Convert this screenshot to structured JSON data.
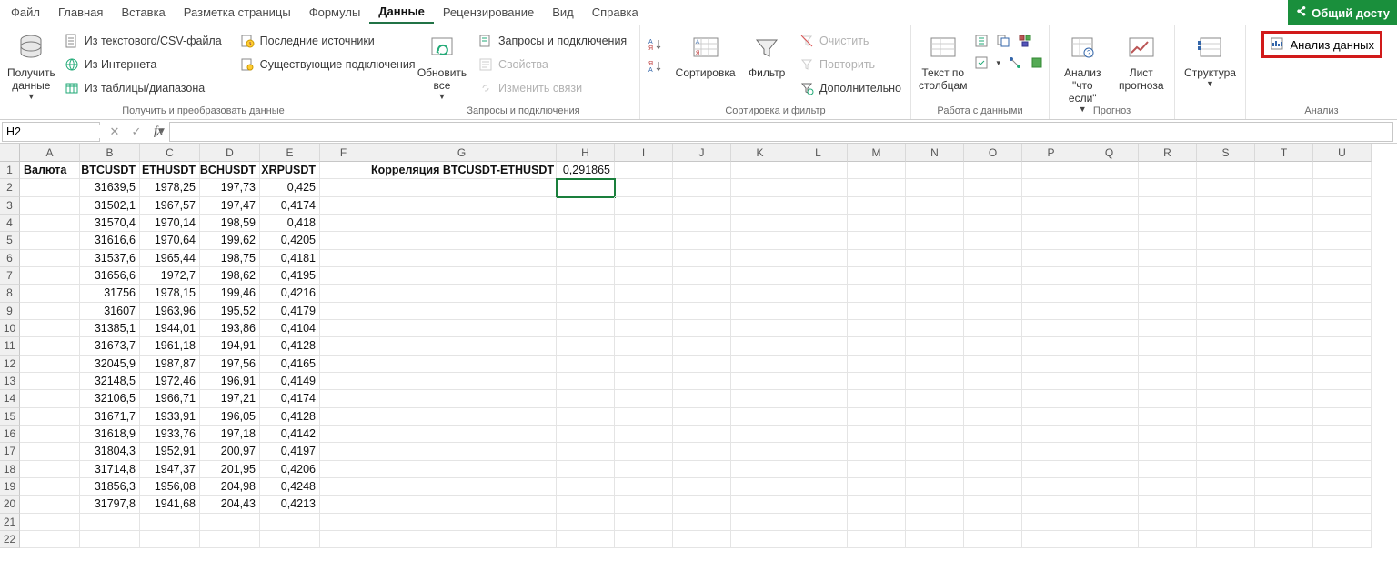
{
  "menu": {
    "items": [
      "Файл",
      "Главная",
      "Вставка",
      "Разметка страницы",
      "Формулы",
      "Данные",
      "Рецензирование",
      "Вид",
      "Справка"
    ],
    "active": 5,
    "share": "Общий досту"
  },
  "ribbon": {
    "get_transform": {
      "big": {
        "label": "Получить данные"
      },
      "csv": "Из текстового/CSV-файла",
      "web": "Из Интернета",
      "range": "Из таблицы/диапазона",
      "recent": "Последние источники",
      "existing": "Существующие подключения",
      "group": "Получить и преобразовать данные"
    },
    "queries": {
      "big": {
        "label": "Обновить все"
      },
      "qc": "Запросы и подключения",
      "props": "Свойства",
      "links": "Изменить связи",
      "group": "Запросы и подключения"
    },
    "sortfilter": {
      "sort": "Сортировка",
      "filter": "Фильтр",
      "clear": "Очистить",
      "reapply": "Повторить",
      "advanced": "Дополнительно",
      "group": "Сортировка и фильтр"
    },
    "datatools": {
      "ttc": "Текст по столбцам",
      "group": "Работа с данными"
    },
    "forecast": {
      "whatif": "Анализ \"что если\"",
      "sheet": "Лист прогноза",
      "group": "Прогноз"
    },
    "outline": {
      "label": "Структура",
      "group": " "
    },
    "analysis": {
      "btn": "Анализ данных",
      "group": "Анализ"
    }
  },
  "namebox": "H2",
  "columns": [
    "A",
    "B",
    "C",
    "D",
    "E",
    "F",
    "G",
    "H",
    "I",
    "J",
    "K",
    "L",
    "M",
    "N",
    "O",
    "P",
    "Q",
    "R",
    "S",
    "T",
    "U"
  ],
  "sheet": {
    "headers": {
      "A": "Валюта",
      "B": "BTCUSDT",
      "C": "ETHUSDT",
      "D": "BCHUSDT",
      "E": "XRPUSDT"
    },
    "g1": "Корреляция BTCUSDT-ETHUSDT",
    "h1": "0,291865",
    "rows": [
      {
        "B": "31639,5",
        "C": "1978,25",
        "D": "197,73",
        "E": "0,425"
      },
      {
        "B": "31502,1",
        "C": "1967,57",
        "D": "197,47",
        "E": "0,4174"
      },
      {
        "B": "31570,4",
        "C": "1970,14",
        "D": "198,59",
        "E": "0,418"
      },
      {
        "B": "31616,6",
        "C": "1970,64",
        "D": "199,62",
        "E": "0,4205"
      },
      {
        "B": "31537,6",
        "C": "1965,44",
        "D": "198,75",
        "E": "0,4181"
      },
      {
        "B": "31656,6",
        "C": "1972,7",
        "D": "198,62",
        "E": "0,4195"
      },
      {
        "B": "31756",
        "C": "1978,15",
        "D": "199,46",
        "E": "0,4216"
      },
      {
        "B": "31607",
        "C": "1963,96",
        "D": "195,52",
        "E": "0,4179"
      },
      {
        "B": "31385,1",
        "C": "1944,01",
        "D": "193,86",
        "E": "0,4104"
      },
      {
        "B": "31673,7",
        "C": "1961,18",
        "D": "194,91",
        "E": "0,4128"
      },
      {
        "B": "32045,9",
        "C": "1987,87",
        "D": "197,56",
        "E": "0,4165"
      },
      {
        "B": "32148,5",
        "C": "1972,46",
        "D": "196,91",
        "E": "0,4149"
      },
      {
        "B": "32106,5",
        "C": "1966,71",
        "D": "197,21",
        "E": "0,4174"
      },
      {
        "B": "31671,7",
        "C": "1933,91",
        "D": "196,05",
        "E": "0,4128"
      },
      {
        "B": "31618,9",
        "C": "1933,76",
        "D": "197,18",
        "E": "0,4142"
      },
      {
        "B": "31804,3",
        "C": "1952,91",
        "D": "200,97",
        "E": "0,4197"
      },
      {
        "B": "31714,8",
        "C": "1947,37",
        "D": "201,95",
        "E": "0,4206"
      },
      {
        "B": "31856,3",
        "C": "1956,08",
        "D": "204,98",
        "E": "0,4248"
      },
      {
        "B": "31797,8",
        "C": "1941,68",
        "D": "204,43",
        "E": "0,4213"
      }
    ]
  }
}
